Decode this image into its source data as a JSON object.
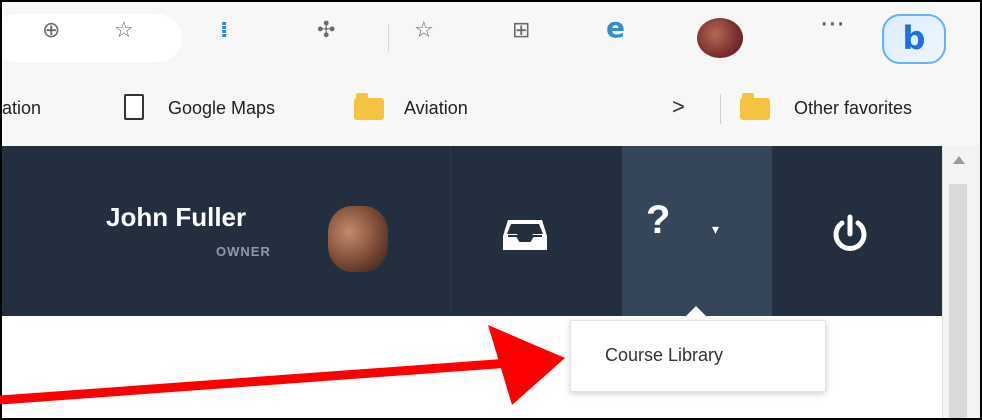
{
  "browser": {
    "toolbar_icons": [
      "zoom-in-icon",
      "favorite-add-icon",
      "bars-extension-icon",
      "extensions-icon",
      "favorites-icon",
      "collections-icon",
      "edge-e-icon",
      "profile-avatar",
      "more-icon",
      "bing-icon"
    ],
    "more_label": "···",
    "bing_label": "b"
  },
  "bookmarks": {
    "items": [
      {
        "label": "ation"
      },
      {
        "label": "Google Maps"
      },
      {
        "label": "Aviation"
      }
    ],
    "overflow_chevron": ">",
    "other_favorites": "Other favorites"
  },
  "header": {
    "user": {
      "name": "John Fuller",
      "role": "OWNER"
    },
    "help_label": "?",
    "help_caret": "▾"
  },
  "dropdown": {
    "items": [
      {
        "label": "Course Library"
      }
    ]
  },
  "colors": {
    "header_bg": "#232f3f",
    "help_active_bg": "#36465a",
    "annotation_arrow": "#ff0000"
  }
}
